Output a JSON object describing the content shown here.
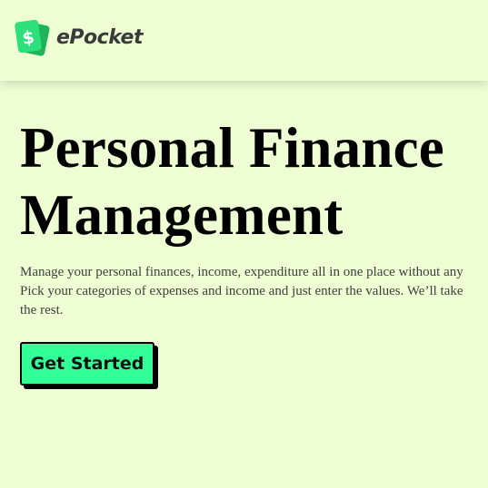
{
  "header": {
    "logo_icon": "dollar-cash-icon",
    "brand_name": "ePocket"
  },
  "hero": {
    "title_line1": "Personal Finance",
    "title_line2": "Management",
    "description_lines": [
      "Manage your personal finances, income, expenditure all in one place without any",
      "Pick your categories of expenses and income and just enter the values. We’ll take",
      "the rest."
    ],
    "cta_label": "Get Started"
  },
  "colors": {
    "background": "#eeffd4",
    "logo_green": "#2ee07a",
    "logo_dark_green": "#1fb35e",
    "cta_fill": "#33ff99",
    "cta_border": "#000000"
  }
}
